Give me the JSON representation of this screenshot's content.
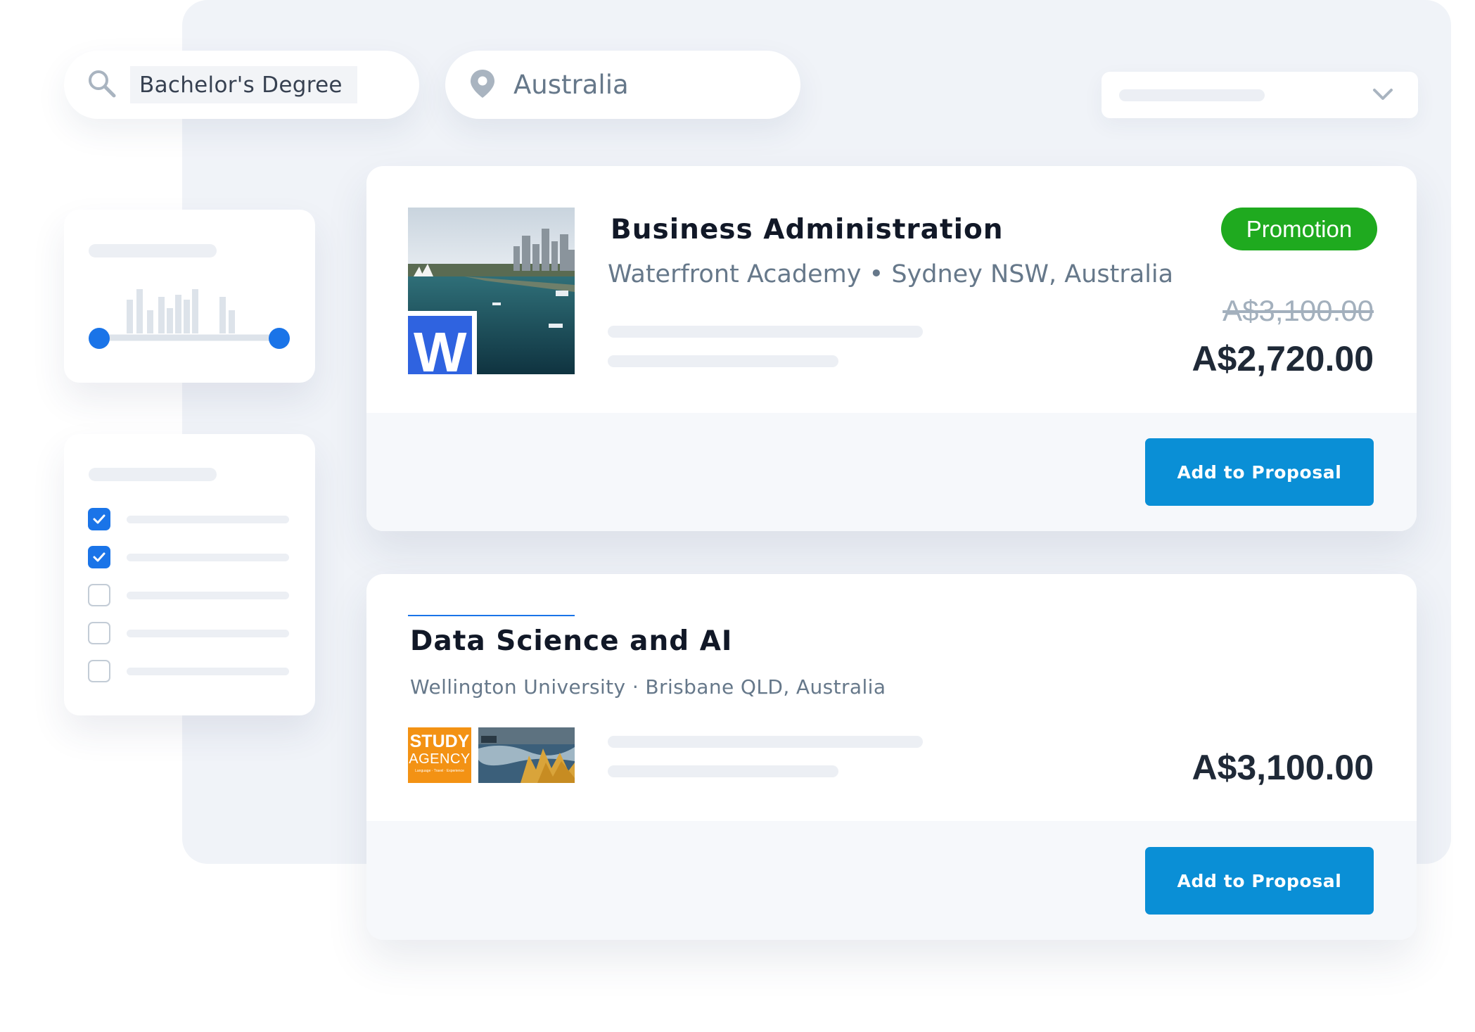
{
  "search": {
    "query": "Bachelor's Degree",
    "location": "Australia"
  },
  "results": [
    {
      "title": "Business Administration",
      "subtitle": "Waterfront Academy • Sydney NSW, Australia",
      "badge": "Promotion",
      "original_price": "A$3,100.00",
      "price": "A$2,720.00",
      "logo_text": "W",
      "button_label": "Add to Proposal"
    },
    {
      "title": "Data Science and AI",
      "subtitle": "Wellington University · Brisbane QLD, Australia",
      "price": "A$3,100.00",
      "logo_text_top": "STUDY",
      "logo_text_bottom": "AGENCY",
      "logo_text_small": "Language · Travel · Experience",
      "button_label": "Add to Proposal"
    }
  ],
  "filters": {
    "checkboxes": [
      true,
      true,
      false,
      false,
      false
    ]
  },
  "colors": {
    "accent": "#1a74e8",
    "button": "#0a8fd6",
    "promotion": "#1faa1f",
    "panel": "#f0f3f8"
  }
}
